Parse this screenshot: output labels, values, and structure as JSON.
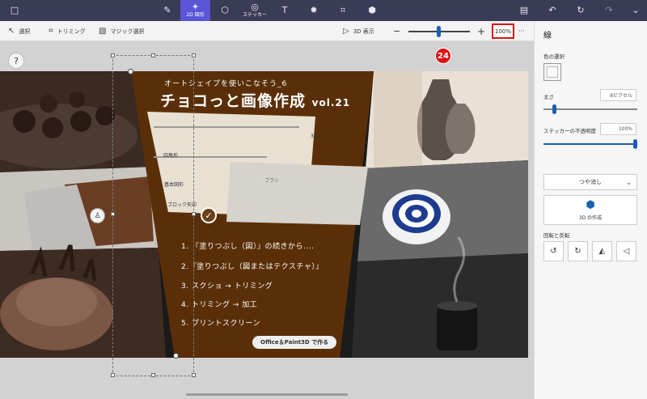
{
  "topbar": {
    "items": [
      {
        "name": "menu-icon",
        "glyph": "□",
        "label": ""
      },
      {
        "name": "brush-icon",
        "glyph": "✎",
        "label": ""
      },
      {
        "name": "2d-shapes-icon",
        "glyph": "✦",
        "label": "2D 図形"
      },
      {
        "name": "3d-shapes-icon",
        "glyph": "⬡",
        "label": ""
      },
      {
        "name": "stickers-icon",
        "glyph": "◎",
        "label": "ステッカー"
      },
      {
        "name": "text-icon",
        "glyph": "T",
        "label": ""
      },
      {
        "name": "effects-icon",
        "glyph": "✹",
        "label": ""
      },
      {
        "name": "canvas-icon",
        "glyph": "⌗",
        "label": ""
      },
      {
        "name": "3d-library-icon",
        "glyph": "⬢",
        "label": ""
      },
      {
        "name": "paste-icon",
        "glyph": "▤",
        "label": ""
      },
      {
        "name": "undo-icon",
        "glyph": "↶",
        "label": ""
      },
      {
        "name": "history-icon",
        "glyph": "↻",
        "label": ""
      },
      {
        "name": "redo-icon",
        "glyph": "↷",
        "label": ""
      },
      {
        "name": "expand-icon",
        "glyph": "⌄",
        "label": ""
      }
    ]
  },
  "subbar": {
    "select": "選択",
    "crop": "トリミング",
    "magic_select": "マジック選択",
    "view3d": "3D 表示",
    "zoom_minus": "−",
    "zoom_plus": "+",
    "zoom_value": "100%",
    "more": "···"
  },
  "canvas": {
    "help": "?",
    "marker": "24",
    "headline_small": "オートシェイプを使いこなそう_6",
    "headline_big": "チョコっと画像作成",
    "headline_vol": "vol.21",
    "steps": [
      "1. 『塗りつぶし（図）』の続きから....",
      "2.『塗りつぶし（図またはテクスチャ）』",
      "3. スクショ → トリミング",
      "4. トリミング → 加工",
      "5. プリントスクリーン"
    ],
    "badge": "Office＆Paint3D で作る",
    "screenshot_labels": {
      "shape_quad": "四角形",
      "shape_basic": "基本図形",
      "block_arrow": "ブロック矢印",
      "brush": "ブラシ",
      "pt": "3 pt"
    }
  },
  "panel": {
    "title": "線",
    "color_label": "色の選択",
    "thickness_label": "太さ",
    "thickness_value": "8ピクセル",
    "thickness_level": 0.1,
    "opacity_label": "ステッカーの不透明度",
    "opacity_value": "100%",
    "opacity_level": 1.0,
    "finish_value": "つや消し",
    "make3d_label": "3D の作成",
    "rotate_label": "回転と反転"
  }
}
